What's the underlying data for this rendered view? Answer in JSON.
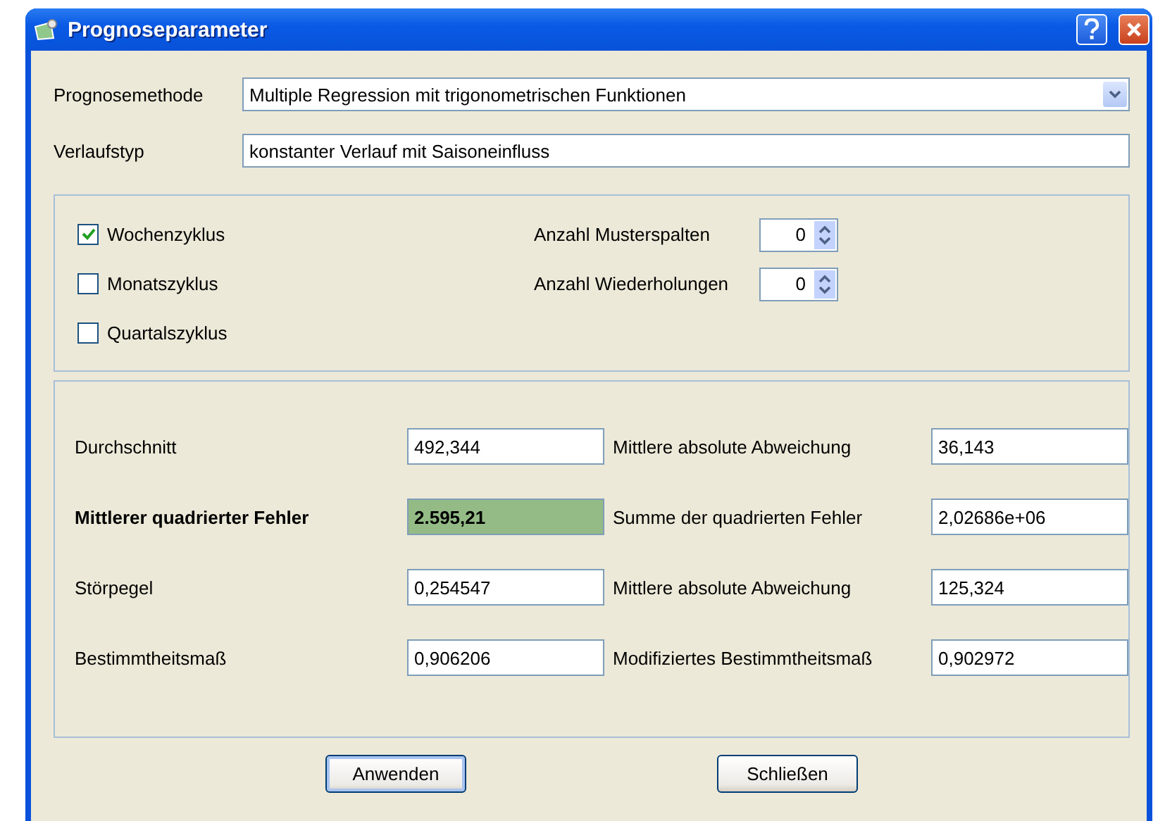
{
  "window": {
    "title": "Prognoseparameter"
  },
  "method": {
    "label": "Prognosemethode",
    "value": "Multiple Regression mit trigonometrischen Funktionen"
  },
  "curve_type": {
    "label": "Verlaufstyp",
    "value": "konstanter Verlauf mit Saisoneinfluss"
  },
  "cycles": [
    {
      "label": "Wochenzyklus",
      "checked": true
    },
    {
      "label": "Monatszyklus",
      "checked": false
    },
    {
      "label": "Quartalszyklus",
      "checked": false
    }
  ],
  "spinners": [
    {
      "label": "Anzahl Musterspalten",
      "value": "0"
    },
    {
      "label": "Anzahl Wiederholungen",
      "value": "0"
    }
  ],
  "metrics": [
    {
      "label": "Durchschnitt",
      "value": "492,344",
      "highlighted": false
    },
    {
      "label": "Mittlere absolute Abweichung",
      "value": "36,143",
      "highlighted": false
    },
    {
      "label": "Mittlerer quadrierter Fehler",
      "value": "2.595,21",
      "highlighted": true
    },
    {
      "label": "Summe der quadrierten Fehler",
      "value": "2,02686e+06",
      "highlighted": false
    },
    {
      "label": "Störpegel",
      "value": "0,254547",
      "highlighted": false
    },
    {
      "label": "Mittlere absolute Abweichung",
      "value": "125,324",
      "highlighted": false
    },
    {
      "label": "Bestimmtheitsmaß",
      "value": "0,906206",
      "highlighted": false
    },
    {
      "label": "Modifiziertes Bestimmtheitsmaß",
      "value": "0,902972",
      "highlighted": false
    }
  ],
  "buttons": [
    {
      "label": "Anwenden",
      "selected": true
    },
    {
      "label": "Schließen",
      "selected": false
    }
  ]
}
